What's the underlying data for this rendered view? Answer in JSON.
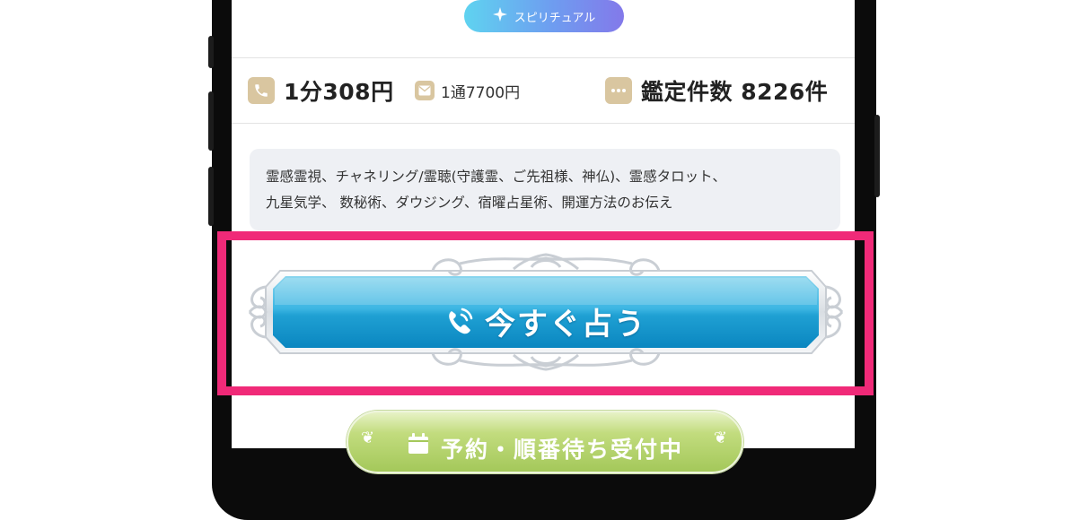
{
  "tag": {
    "label": "スピリチュアル",
    "icon": "sparkle-icon"
  },
  "pricing": {
    "phone": {
      "icon": "phone-icon",
      "text": "1分308円"
    },
    "mail": {
      "icon": "mail-icon",
      "text": "1通7700円"
    },
    "count": {
      "icon": "chat-bubble-icon",
      "text": "鑑定件数 8226件"
    }
  },
  "skills": {
    "line1": "霊感霊視、チャネリング/霊聴(守護霊、ご先祖様、神仏)、霊感タロット、",
    "line2": "九星気学、 数秘術、ダウジング、宿曜占星術、開運方法のお伝え"
  },
  "cta": {
    "label": "今すぐ占う",
    "icon": "phone-call-icon"
  },
  "reserve": {
    "label": "予約・順番待ち受付中",
    "icon": "calendar-icon"
  },
  "colors": {
    "highlight": "#f02a78",
    "icon_bg": "#d9c6a0",
    "cta_blue": "#1e98c9",
    "reserve_green": "#a4c85a"
  }
}
